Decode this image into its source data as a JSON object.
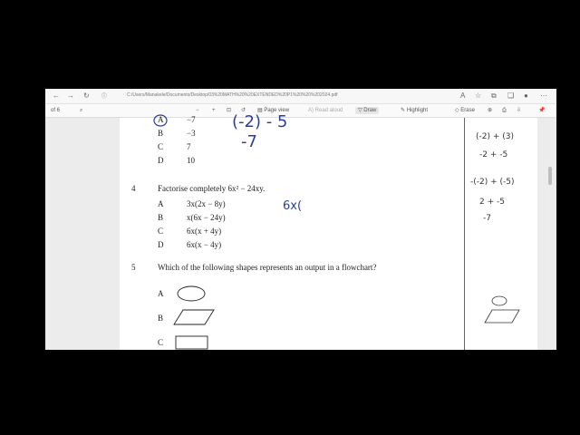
{
  "browser": {
    "url": "C:/Users/Manakele/Documents/Desktop/03%20MATH%20%20EXTENDED%20P1%20%20%202024.pdf"
  },
  "toolbar": {
    "page_counter": "of 6",
    "page_view": "Page view",
    "read_aloud": "Read aloud",
    "draw": "Draw",
    "highlight": "Highlight",
    "erase": "Erase"
  },
  "questions": {
    "q3_partial": {
      "options": [
        {
          "letter": "A",
          "value": "−7"
        },
        {
          "letter": "B",
          "value": "−3"
        },
        {
          "letter": "C",
          "value": "7"
        },
        {
          "letter": "D",
          "value": "10"
        }
      ]
    },
    "q4": {
      "number": "4",
      "text": "Factorise completely 6x² − 24xy.",
      "options": [
        {
          "letter": "A",
          "value": "3x(2x − 8y)"
        },
        {
          "letter": "B",
          "value": "x(6x − 24y)"
        },
        {
          "letter": "C",
          "value": "6x(x + 4y)"
        },
        {
          "letter": "D",
          "value": "6x(x − 4y)"
        }
      ]
    },
    "q5": {
      "number": "5",
      "text": "Which of the following shapes represents an output in a flowchart?",
      "options": [
        {
          "letter": "A",
          "shape": "oval"
        },
        {
          "letter": "B",
          "shape": "parallelogram"
        },
        {
          "letter": "C",
          "shape": "rectangle"
        }
      ]
    }
  },
  "annotations": {
    "page_ink": [
      "(-2) - 5",
      "-7",
      "6x("
    ],
    "margin_ink": [
      "(-2) + (3)",
      "-2 + -5",
      "-(-2) + (-5)",
      "2 + -5",
      "-7"
    ]
  },
  "colors": {
    "ink_blue": "#2a3f9a",
    "ink_dark": "#333333",
    "backdrop": "#000000"
  }
}
